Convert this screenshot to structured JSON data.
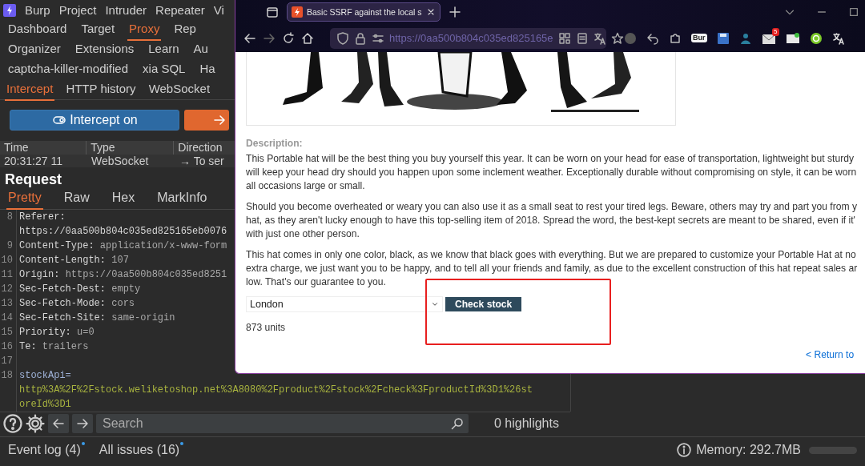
{
  "burp": {
    "menu": [
      "Burp",
      "Project",
      "Intruder",
      "Repeater",
      "Vi"
    ],
    "tab_rows": [
      [
        {
          "label": "Dashboard",
          "selected": false
        },
        {
          "label": "Target",
          "selected": false
        },
        {
          "label": "Proxy",
          "selected": true
        },
        {
          "label": "Rep",
          "selected": false
        }
      ],
      [
        {
          "label": "Organizer",
          "selected": false
        },
        {
          "label": "Extensions",
          "selected": false
        },
        {
          "label": "Learn",
          "selected": false
        },
        {
          "label": "Au",
          "selected": false
        }
      ],
      [
        {
          "label": "captcha-killer-modified",
          "selected": false
        },
        {
          "label": "xia SQL",
          "selected": false
        },
        {
          "label": "Ha",
          "selected": false
        }
      ]
    ],
    "proxy_tabs": [
      {
        "label": "Intercept",
        "selected": true
      },
      {
        "label": "HTTP history",
        "selected": false
      },
      {
        "label": "WebSocket",
        "selected": false
      }
    ],
    "intercept_button": "Intercept on",
    "history": {
      "columns": [
        "Time",
        "Type",
        "Direction"
      ],
      "rows": [
        [
          "20:31:27 11",
          "WebSocket",
          "→ To ser"
        ]
      ]
    },
    "request": {
      "title": "Request",
      "tabs": [
        {
          "label": "Pretty",
          "selected": true
        },
        {
          "label": "Raw",
          "selected": false
        },
        {
          "label": "Hex",
          "selected": false
        },
        {
          "label": "MarkInfo",
          "selected": false
        }
      ],
      "lines": [
        {
          "number": "8",
          "kind": "header",
          "name": "Referer:",
          "continuation": [
            "https://0aa500b804c035ed825165eb0076"
          ]
        },
        {
          "number": "9",
          "kind": "header",
          "name": "Content-Type:",
          "value": "application/x-www-form"
        },
        {
          "number": "10",
          "kind": "header",
          "name": "Content-Length:",
          "value": "107"
        },
        {
          "number": "11",
          "kind": "header",
          "name": "Origin:",
          "value": "https://0aa500b804c035ed8251"
        },
        {
          "number": "12",
          "kind": "header",
          "name": "Sec-Fetch-Dest:",
          "value": "empty"
        },
        {
          "number": "13",
          "kind": "header",
          "name": "Sec-Fetch-Mode:",
          "value": "cors"
        },
        {
          "number": "14",
          "kind": "header",
          "name": "Sec-Fetch-Site:",
          "value": "same-origin"
        },
        {
          "number": "15",
          "kind": "header",
          "name": "Priority:",
          "value": "u=0"
        },
        {
          "number": "16",
          "kind": "header",
          "name": "Te:",
          "value": "trailers"
        },
        {
          "number": "17",
          "kind": "blank"
        },
        {
          "number": "18",
          "kind": "param",
          "name": "stockApi=",
          "continuation": [
            "http%3A%2F%2Fstock.weliketoshop.net%3A8080%2Fproduct%2Fstock%2Fcheck%3FproductId%3D1%26st",
            "oreId%3D1"
          ]
        }
      ]
    },
    "search": {
      "placeholder": "Search",
      "highlights": "0 highlights"
    },
    "status": {
      "event_log": {
        "label": "Event log (4)",
        "notify": true
      },
      "issues": {
        "label": "All issues (16)",
        "notify": true
      },
      "memory": "Memory: 292.7MB"
    }
  },
  "browser": {
    "tab_title": "Basic SSRF against the local s",
    "url": "https://0aa500b804c035ed825165e",
    "badge_label": "Bur",
    "mail_count": "5",
    "page": {
      "description_label": "Description:",
      "paragraphs": [
        [
          "This Portable hat will be the best thing you buy yourself this year. It can be worn on your head for ease of transportation, lightweight but sturdy",
          "will keep your head dry should you happen upon some inclement weather. Exceptionally durable without compromising on style, it can be worn",
          "all occasions large or small."
        ],
        [
          "Should you become overheated or weary you can also use it as a small seat to rest your tired legs. Beware, others may try and part you from y",
          "hat, as they aren't lucky enough to have this top-selling item of 2018. Spread the word, the best-kept secrets are meant to be shared, even if it'",
          "with just one other person."
        ],
        [
          "This hat comes in only one color, black, as we know that black goes with everything. But we are prepared to customize your Portable Hat at no",
          "extra charge, we just want you to be happy, and to tell all your friends and family, as due to the excellent construction of this hat repeat sales ar",
          "low. That's our guarantee to you."
        ]
      ],
      "store": "London",
      "check_button": "Check stock",
      "result": "873 units",
      "return_link": "< Return to"
    }
  }
}
